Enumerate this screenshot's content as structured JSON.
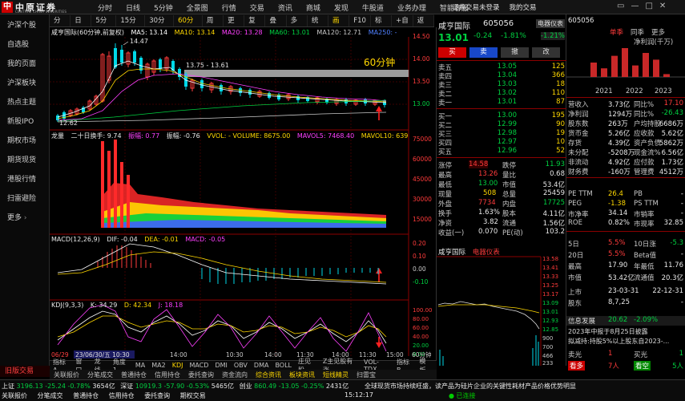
{
  "app": {
    "logo_mark": "中",
    "logo_name": "中原证券",
    "logo_sub": "CENTRAL CHINA SECURITIES"
  },
  "top_menu": [
    "分时",
    "日线",
    "5分钟",
    "全景图",
    "行情",
    "交易",
    "资讯",
    "商城",
    "发现",
    "牛股道",
    "业务办理",
    "智能客服"
  ],
  "top_right": [
    "证券交易未登录",
    "我的交易"
  ],
  "window_buttons": [
    "▭",
    "—",
    "□",
    "✕"
  ],
  "sidebar": {
    "items": [
      "沪深个股",
      "自选股",
      "我的页面",
      "沪深板块",
      "热点主题",
      "新股IPO",
      "期权市场",
      "期货现货",
      "港股行情",
      "扫雷避险",
      "更多"
    ],
    "bottom": "旧版交易"
  },
  "toolbar": {
    "tabs": [
      "分时",
      "日线",
      "5分钟",
      "15分钟",
      "30分钟",
      "60分钟",
      "周线",
      "更多",
      "复权",
      "叠加",
      "多股",
      "统计",
      "画线",
      "F10",
      "标记",
      "+自",
      "返回"
    ],
    "active": "60分钟"
  },
  "chart": {
    "stock_title": "咸亨国际(60分钟,前复权)",
    "ma": [
      {
        "label": "MA5: 13.14",
        "color": "#ffffff"
      },
      {
        "label": "MA10: 13.14",
        "color": "#ffd800"
      },
      {
        "label": "MA20: 13.28",
        "color": "#ff40ff"
      },
      {
        "label": "MA60: 13.01",
        "color": "#00d040"
      },
      {
        "label": "MA120: 12.71",
        "color": "#c8c8c8"
      },
      {
        "label": "MA250: -",
        "color": "#5080ff"
      }
    ],
    "price_axis": [
      "14.50",
      "14.00",
      "13.50",
      "13.00"
    ],
    "annot_high": "14.47",
    "annot_low": "12.62",
    "annot_range": "13.75 - 13.61",
    "annot_label": "60分钟",
    "vol_head": {
      "name": "龙量",
      "sub": "二十日换手: 9.74",
      "f1": "振幅: 0.77",
      "f2": "振幅: -0.76",
      "f3": "VVOL: - VOLUME: 8675.00",
      "f4": "MAVOL5: 7468.40",
      "f5": "MAVOL10: 639"
    },
    "vol_axis": [
      "75000",
      "60000",
      "45000",
      "30000",
      "15000"
    ],
    "macd_head": {
      "name": "MACD(12,26,9)",
      "dif": "DIF: -0.04",
      "dea": "DEA: -0.01",
      "macd": "MACD: -0.05"
    },
    "macd_axis": [
      "0.20",
      "0.10",
      "0.00",
      "-0.10"
    ],
    "kdj_head": {
      "name": "KDJ(9,3,3)",
      "k": "K: 34.29",
      "d": "D: 42.34",
      "j": "J: 18.18"
    },
    "kdj_axis": [
      "100.00",
      "80.00",
      "60.00",
      "40.00",
      "20.00",
      "0.00"
    ],
    "time_labels": [
      "06/29",
      "23/06/30/五 10:30",
      "14:00",
      "10:30",
      "14:00",
      "11:30",
      "14:00",
      "11:30",
      "15:00"
    ],
    "period_label": "60分钟"
  },
  "bottom_tabs": [
    "指标A",
    "窗口",
    "龙线",
    "角度1",
    "MA",
    "MA2",
    "KDJ",
    "MACD",
    "DMI",
    "OBV",
    "DMA",
    "BOLL",
    "庄见股",
    "Z主见股有涨",
    "VOL-TDX",
    "指标B",
    "模 板"
  ],
  "tab_bar2": [
    "关联报价",
    "分笔成交",
    "普通持仓",
    "信用持仓",
    "委托查询",
    "资金流向",
    "综合资讯",
    "板块资讯",
    "短线精灵",
    "扫雷宝"
  ],
  "status": {
    "items": [
      {
        "label": "上证",
        "value": "3196.13",
        "chg": "-25.24",
        "pct": "-0.78%",
        "amt": "3654亿"
      },
      {
        "label": "深证",
        "value": "10919.3",
        "chg": "-57.90",
        "pct": "-0.53%",
        "amt": "5465亿"
      },
      {
        "label": "创业",
        "value": "860.49",
        "chg": "-13.05",
        "pct": "-0.25%",
        "amt": "2431亿"
      }
    ],
    "nav": [
      "关联报价",
      "分笔成交",
      "普通持仓",
      "信用持仓",
      "委托查询",
      "期权交易"
    ],
    "ticker": "全球现货市场持续旺盛，读产品为硅片企业的关键性耗材，公司营收...",
    "time": "15:12:17",
    "status_text": "已连接",
    "alert": "产品价格优势明显"
  },
  "quote": {
    "name": "咸亨国际",
    "code": "605056",
    "badge": "电器仪表",
    "price": "13.01",
    "chg": "-0.24",
    "pct": "-1.81%",
    "ind_pct": "-1.21%",
    "buttons": [
      "买",
      "卖",
      "撤",
      "改"
    ],
    "sells": [
      {
        "label": "卖五",
        "price": "13.05",
        "vol": "125"
      },
      {
        "label": "卖四",
        "price": "13.04",
        "vol": "366"
      },
      {
        "label": "卖三",
        "price": "13.03",
        "vol": "18"
      },
      {
        "label": "卖二",
        "price": "13.02",
        "vol": "110"
      },
      {
        "label": "卖一",
        "price": "13.01",
        "vol": "87"
      }
    ],
    "buys": [
      {
        "label": "买一",
        "price": "13.00",
        "vol": "195"
      },
      {
        "label": "买二",
        "price": "12.99",
        "vol": "90"
      },
      {
        "label": "买三",
        "price": "12.98",
        "vol": "19"
      },
      {
        "label": "买四",
        "price": "12.97",
        "vol": "10"
      },
      {
        "label": "买五",
        "price": "12.96",
        "vol": "52"
      }
    ],
    "stats": [
      {
        "a": "涨停",
        "av": "14.58",
        "b": "跌停",
        "bv": "11.93"
      },
      {
        "a": "最高",
        "av": "13.26",
        "b": "量比",
        "bv": "0.68"
      },
      {
        "a": "最低",
        "av": "13.00",
        "b": "市值",
        "bv": "53.4亿"
      },
      {
        "a": "现量",
        "av": "508",
        "b": "总量",
        "bv": "25459"
      },
      {
        "a": "外盘",
        "av": "7734",
        "b": "内盘",
        "bv": "17725"
      },
      {
        "a": "换手",
        "av": "1.63%",
        "b": "股本",
        "bv": "4.11亿"
      },
      {
        "a": "净资",
        "av": "3.82",
        "b": "流通",
        "bv": "1.56亿"
      },
      {
        "a": "收益(一)",
        "av": "0.070",
        "b": "PE(动)",
        "bv": "103.2"
      }
    ],
    "mini_title": "咸亨国际",
    "mini_badge": "电器仪表",
    "mini_axis": [
      "13.58",
      "13.41",
      "13.33",
      "13.25",
      "13.17",
      "13.09",
      "13.01",
      "12.93",
      "12.85"
    ],
    "mini_axis2": [
      "900",
      "700",
      "466",
      "233"
    ],
    "news_label": "信息发展",
    "news_val": "20.62",
    "news_pct": "-2.09%"
  },
  "fund": {
    "code": "605056",
    "tabs": [
      "单季",
      "同季",
      "更多"
    ],
    "bar_title": "净利润(千万)",
    "years": [
      "2021",
      "2022",
      "2023"
    ],
    "bars": [
      {
        "v": 15
      },
      {
        "v": 9
      },
      {
        "v": 22
      },
      {
        "v": 30
      },
      {
        "v": 12
      },
      {
        "v": 25
      },
      {
        "v": 18
      },
      {
        "v": 3
      }
    ],
    "rows": [
      {
        "a": "营收入",
        "b": "3.73亿",
        "c": "同比%",
        "d": "17.10"
      },
      {
        "a": "净利润",
        "b": "1294万",
        "c": "同比%",
        "d": "-26.43"
      },
      {
        "a": "股东数",
        "b": "263万",
        "c": "户均持股",
        "d": "6686万"
      },
      {
        "a": "货币金",
        "b": "5.26亿",
        "c": "应收款",
        "d": "5.62亿"
      },
      {
        "a": "存货",
        "b": "4.39亿",
        "c": "资产负债",
        "d": "5862万"
      },
      {
        "a": "未分配",
        "b": "-5208万",
        "c": "现金流%",
        "d": "6.56亿"
      },
      {
        "a": "非流动",
        "b": "4.92亿",
        "c": "应付款",
        "d": "1.73亿"
      },
      {
        "a": "财务费",
        "b": "-160万",
        "c": "管理费",
        "d": "4512万"
      }
    ],
    "val_rows": [
      {
        "a": "PE TTM",
        "b": "26.4",
        "c": "PB",
        "d": "-"
      },
      {
        "a": "PEG",
        "b": "-1.38",
        "c": "PS TTM",
        "d": "-"
      },
      {
        "a": "市净率",
        "b": "34.14",
        "c": "市销率",
        "d": "-"
      },
      {
        "a": "ROE",
        "b": "0.82%",
        "c": "市现率",
        "d": "32.85"
      }
    ],
    "more_rows": [
      {
        "a": "5日",
        "b": "5.5%",
        "c": "10日涨",
        "d": "-5.3"
      },
      {
        "a": "20日",
        "b": "5.5%",
        "c": "Beta值",
        "d": "-"
      },
      {
        "a": "最高",
        "b": "17.90",
        "c": "年最低",
        "d": "11.76"
      },
      {
        "a": "市值",
        "b": "53.42亿",
        "c": "流通值",
        "d": "20.3亿"
      }
    ],
    "dates": [
      {
        "a": "上市",
        "b": "23-03-31",
        "c": "",
        "d": "22-12-31"
      },
      {
        "a": "股东",
        "b": "8,7,25",
        "c": "",
        "d": "-"
      }
    ],
    "notice1": "2023年中报于8月25日披露",
    "notice2": "拟减持:持股5%以上股东自2023-...",
    "foot": [
      {
        "a": "卖光",
        "b": "1",
        "c": "买光",
        "d": "1"
      },
      {
        "a": "看多",
        "b": "7人",
        "c": "看空",
        "d": "5人"
      }
    ]
  },
  "colors": {
    "up": "#ff3b3b",
    "down": "#00d040",
    "accent": "#ffd800",
    "bg": "#000000"
  }
}
